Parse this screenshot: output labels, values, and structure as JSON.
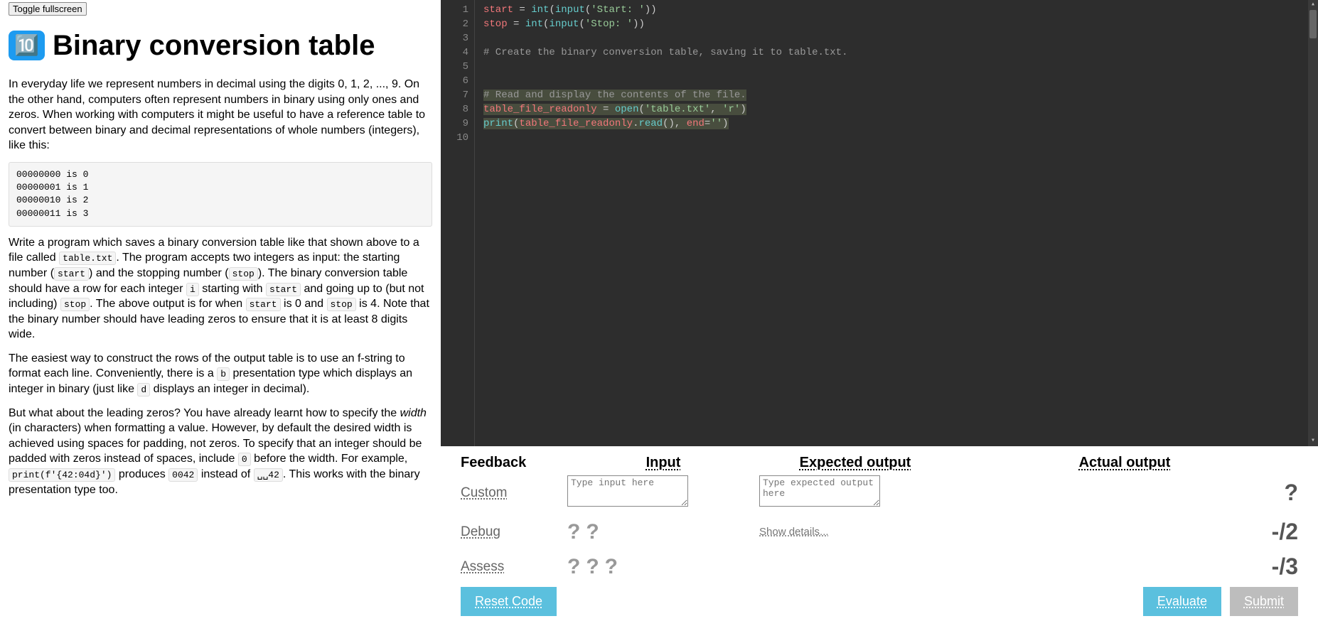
{
  "toggle_label": "Toggle fullscreen",
  "title_icon": "🔟",
  "title": "Binary conversion table",
  "para1": "In everyday life we represent numbers in decimal using the digits 0, 1, 2, ..., 9. On the other hand, computers often represent numbers in binary using only ones and zeros. When working with computers it might be useful to have a reference table to convert between binary and decimal representations of whole numbers (integers), like this:",
  "example_block": "00000000 is 0\n00000001 is 1\n00000010 is 2\n00000011 is 3",
  "para2_parts": {
    "a": "Write a program which saves a binary conversion table like that shown above to a file called ",
    "c1": "table.txt",
    "b": ". The program accepts two integers as input: the starting number (",
    "c2": "start",
    "c": ") and the stopping number (",
    "c3": "stop",
    "d": "). The binary conversion table should have a row for each integer ",
    "c4": "i",
    "e": " starting with ",
    "c5": "start",
    "f": " and going up to (but not including) ",
    "c6": "stop",
    "g": ". The above output is for when ",
    "c7": "start",
    "h": " is 0 and ",
    "c8": "stop",
    "i": " is 4. Note that the binary number should have leading zeros to ensure that it is at least 8 digits wide."
  },
  "para3_parts": {
    "a": "The easiest way to construct the rows of the output table is to use an f-string to format each line. Conveniently, there is a ",
    "c1": "b",
    "b": " presentation type which displays an integer in binary (just like ",
    "c2": "d",
    "c": " displays an integer in decimal)."
  },
  "para4_parts": {
    "a": "But what about the leading zeros? You have already learnt how to specify the ",
    "em": "width",
    "b": " (in characters) when formatting a value. However, by default the desired width is achieved using spaces for padding, not zeros. To specify that an integer should be padded with zeros instead of spaces, include ",
    "c1": "0",
    "c": " before the width. For example, ",
    "c2": "print(f'{42:04d}')",
    "d": " produces ",
    "c3": "0042",
    "e": " instead of ",
    "c4": "␣␣42",
    "f": ". This works with the binary presentation type too."
  },
  "code_lines": [
    {
      "n": 1,
      "html": "<span class='tok-var'>start</span> <span class='tok-op'>=</span> <span class='tok-fn'>int</span>(<span class='tok-fn'>input</span>(<span class='tok-str'>'Start: '</span>))"
    },
    {
      "n": 2,
      "html": "<span class='tok-var'>stop</span> <span class='tok-op'>=</span> <span class='tok-fn'>int</span>(<span class='tok-fn'>input</span>(<span class='tok-str'>'Stop: '</span>))"
    },
    {
      "n": 3,
      "html": ""
    },
    {
      "n": 4,
      "html": "<span class='tok-com'># Create the binary conversion table, saving it to table.txt.</span>"
    },
    {
      "n": 5,
      "html": ""
    },
    {
      "n": 6,
      "html": ""
    },
    {
      "n": 7,
      "html": "<span class='hl'><span class='tok-com'># Read and display the contents of the file.</span></span>"
    },
    {
      "n": 8,
      "html": "<span class='hl'><span class='tok-var'>table_file_readonly</span> <span class='tok-op'>=</span> <span class='tok-fn'>open</span>(<span class='tok-str'>'table.txt'</span>, <span class='tok-str'>'r'</span>)</span>"
    },
    {
      "n": 9,
      "html": "<span class='hl'><span class='tok-fn'>print</span>(<span class='tok-var'>table_file_readonly</span>.<span class='tok-fn'>read</span>(), <span class='tok-var'>end</span><span class='tok-op'>=</span><span class='tok-str'>''</span>)</span>"
    },
    {
      "n": 10,
      "html": ""
    }
  ],
  "feedback": {
    "header": "Feedback",
    "input_header": "Input",
    "expected_header": "Expected output",
    "actual_header": "Actual output",
    "rows": {
      "custom_label": "Custom",
      "debug_label": "Debug",
      "assess_label": "Assess",
      "show_details": "Show details...",
      "custom_score": "?",
      "debug_score": "-/2",
      "assess_score": "-/3"
    },
    "input_placeholder": "Type input here",
    "expected_placeholder": "Type expected output here",
    "buttons": {
      "reset": "Reset Code",
      "evaluate": "Evaluate",
      "submit": "Submit"
    }
  }
}
